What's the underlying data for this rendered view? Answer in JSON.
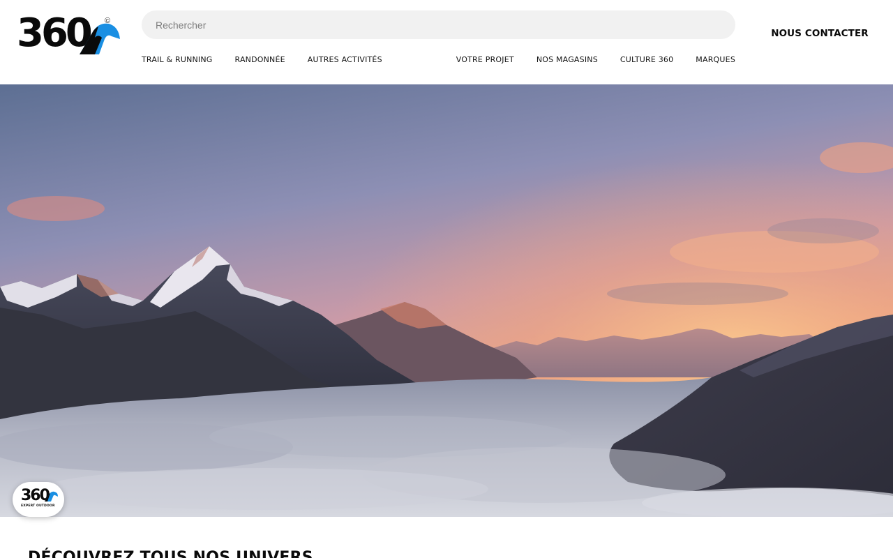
{
  "header": {
    "logo_text": "360",
    "logo_copyright": "©",
    "search_placeholder": "Rechercher",
    "contact_label": "NOUS CONTACTER",
    "nav_left": [
      "TRAIL & RUNNING",
      "RANDONNÉE",
      "AUTRES ACTIVITÉS"
    ],
    "nav_right": [
      "VOTRE PROJET",
      "NOS MAGASINS",
      "CULTURE 360",
      "MARQUES"
    ]
  },
  "hero": {
    "badge_number": "360",
    "badge_subtitle": "EXPERT OUTDOOR"
  },
  "section": {
    "title": "DÉCOUVREZ TOUS NOS UNIVERS"
  },
  "colors": {
    "brand_blue": "#1a8fe3",
    "text_dark": "#0a0a0a",
    "search_bg": "#f1f1f1"
  }
}
